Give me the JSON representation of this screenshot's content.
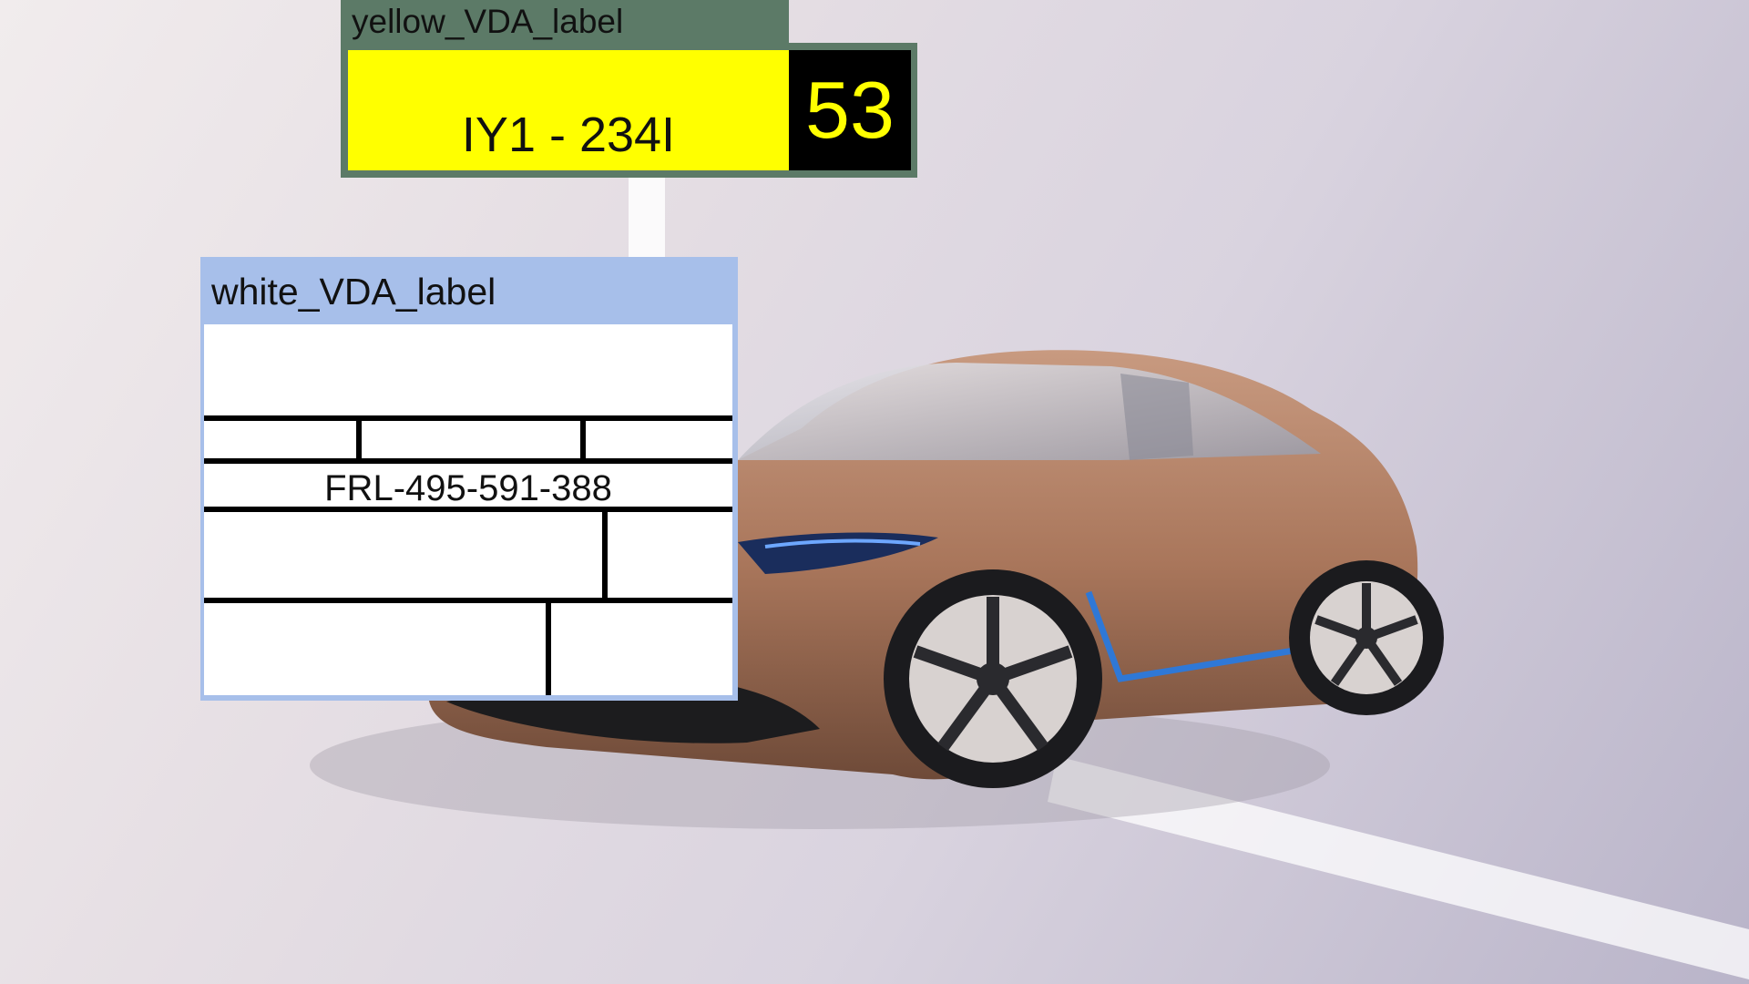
{
  "yellow_label": {
    "title": "yellow_VDA_label",
    "code": "IY1 - 234I",
    "number": "53",
    "colors": {
      "header": "#5c7a67",
      "field": "#ffff00",
      "number_bg": "#000000",
      "number_text": "#ffff00"
    }
  },
  "white_label": {
    "title": "white_VDA_label",
    "code": "FRL-495-591-388",
    "colors": {
      "header": "#a7bfea",
      "field": "#ffffff"
    }
  },
  "background": {
    "subject": "copper-electric-sedan-photo"
  }
}
